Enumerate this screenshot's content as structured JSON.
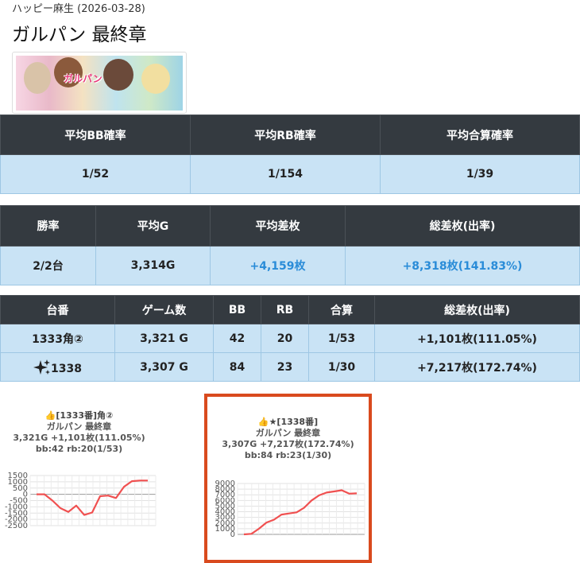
{
  "breadcrumb": "ハッピー麻生 (2026-03-28)",
  "page_title": "ガルパン 最終章",
  "summary1": {
    "headers": [
      "平均BB確率",
      "平均RB確率",
      "平均合算確率"
    ],
    "values": [
      "1/52",
      "1/154",
      "1/39"
    ]
  },
  "summary2": {
    "headers": [
      "勝率",
      "平均G",
      "平均差枚",
      "総差枚(出率)"
    ],
    "values": [
      "2/2台",
      "3,314G",
      "+4,159枚",
      "+8,318枚(141.83%)"
    ]
  },
  "machines": {
    "headers": [
      "台番",
      "ゲーム数",
      "BB",
      "RB",
      "合算",
      "総差枚(出率)"
    ],
    "rows": [
      {
        "id": "1333角②",
        "games": "3,321 G",
        "bb": "42",
        "rb": "20",
        "total": "1/53",
        "diff": "+1,101枚(111.05%)"
      },
      {
        "id": "1338",
        "games": "3,307 G",
        "bb": "84",
        "rb": "23",
        "total": "1/30",
        "diff": "+7,217枚(172.74%)"
      }
    ]
  },
  "colors": {
    "header_bg": "#343a40",
    "cell_bg": "#c9e3f5",
    "positive_text": "#2a8cd8",
    "highlight_border": "#d94a1e",
    "line": "#f05050"
  },
  "charts": [
    {
      "line1": "👍[1333番]角②",
      "line2": "ガルパン 最終章",
      "line3": "3,321G +1,101枚(111.05%)",
      "line4": "bb:42 rb:20(1/53)",
      "chart_data": {
        "type": "line",
        "ylim": [
          -2500,
          1500
        ],
        "yticks": [
          "1500",
          "1000",
          "500",
          "0",
          "-500",
          "-1000",
          "-1500",
          "-2000",
          "-2500"
        ],
        "values": [
          0,
          0,
          -500,
          -1100,
          -1400,
          -900,
          -1650,
          -1450,
          -150,
          -100,
          -300,
          600,
          1050,
          1100,
          1100
        ]
      }
    },
    {
      "line1": "👍★[1338番]",
      "line2": "ガルパン 最終章",
      "line3": "3,307G +7,217枚(172.74%)",
      "line4": "bb:84 rb:23(1/30)",
      "chart_data": {
        "type": "line",
        "ylim": [
          0,
          9000
        ],
        "yticks": [
          "9000",
          "8000",
          "7000",
          "6000",
          "5000",
          "4000",
          "3000",
          "2000",
          "1000",
          "0"
        ],
        "values": [
          0,
          100,
          1000,
          2100,
          2600,
          3500,
          3700,
          3900,
          4700,
          6000,
          6900,
          7400,
          7600,
          7800,
          7200,
          7250
        ]
      }
    }
  ]
}
